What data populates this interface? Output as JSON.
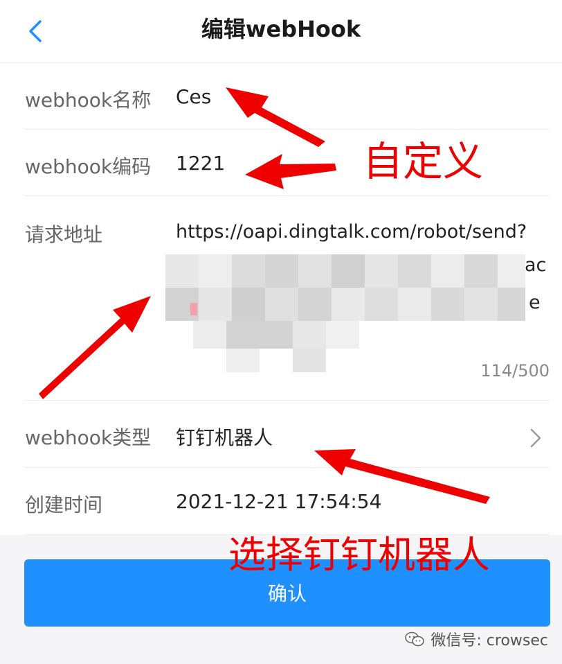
{
  "header": {
    "title": "编辑webHook",
    "back_icon": "chevron-left-icon"
  },
  "form": {
    "name": {
      "label": "webhook名称",
      "value": "Ces"
    },
    "code": {
      "label": "webhook编码",
      "value": "1221"
    },
    "url": {
      "label": "请求地址",
      "line1": "https://oapi.dingtalk.com/robot/send?",
      "line2": "access_toke",
      "line2_tail": "ac",
      "line3_tail": "e",
      "counter": "114/500"
    },
    "type": {
      "label": "webhook类型",
      "value": "钉钉机器人",
      "chevron_icon": "chevron-right-icon"
    },
    "created": {
      "label": "创建时间",
      "value": "2021-12-21 17:54:54"
    }
  },
  "confirm_label": "确认",
  "watermark": "微信号: crowsec",
  "annotations": {
    "custom": "自定义",
    "choose": "选择钉钉机器人"
  },
  "colors": {
    "accent": "#1e90ff",
    "annotation": "#ee0000"
  }
}
